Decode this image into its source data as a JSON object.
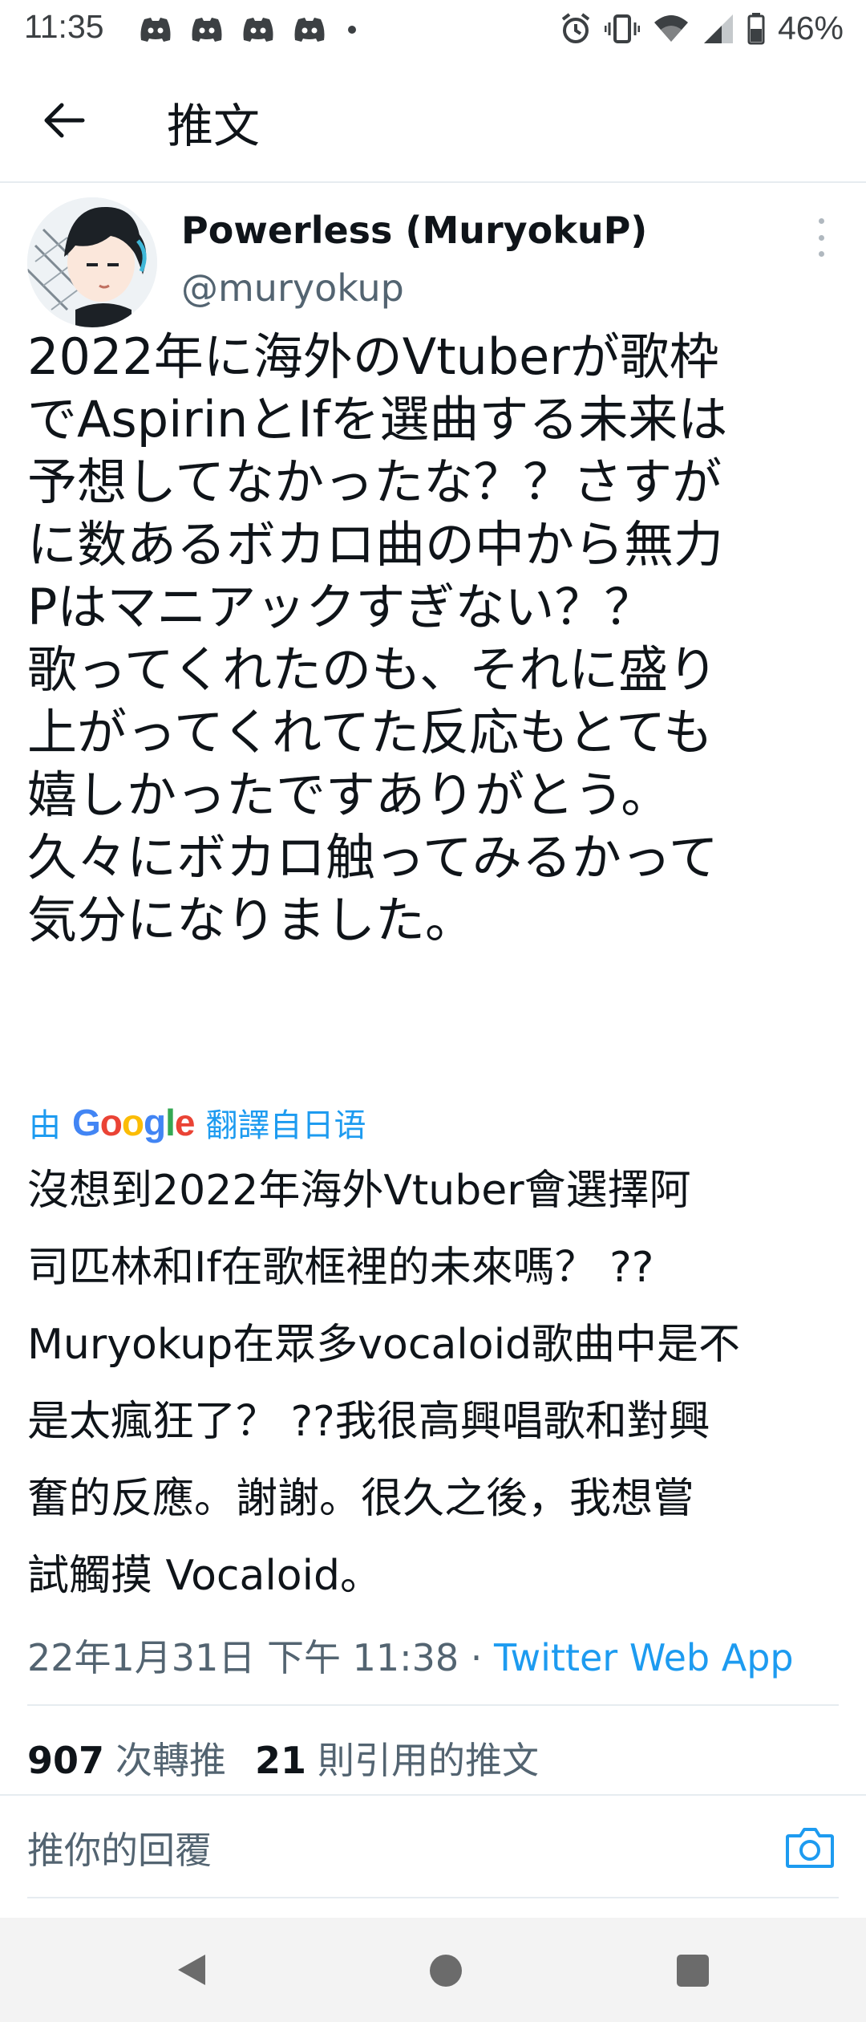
{
  "status_bar": {
    "time": "11:35",
    "battery": "46%",
    "notification_icons": [
      "discord-icon",
      "discord-icon",
      "discord-icon",
      "discord-icon"
    ],
    "system_icons": [
      "alarm-icon",
      "vibrate-icon",
      "wifi-icon",
      "signal-icon",
      "battery-icon"
    ]
  },
  "app_bar": {
    "title": "推文"
  },
  "tweet": {
    "author_name": "Powerless (MuryokuP)",
    "author_handle": "@muryokup",
    "text": "2022年に海外のVtuberが歌枠\nでAspirinとIfを選曲する未来は\n予想してなかったな？？さすが\nに数あるボカロ曲の中から無力\nPはマニアックすぎない？？\n歌ってくれたのも、それに盛り\n上がってくれてた反応もとても\n嬉しかったですありがとう。\n久々にボカロ触ってみるかって\n気分になりました。",
    "translation_prefix": "由",
    "translation_brand": "Google",
    "translation_suffix": "翻譯自日语",
    "translated_text": "沒想到2022年海外Vtuber會選擇阿\n司匹林和If在歌框裡的未來嗎？ ??\nMuryokup在眾多vocaloid歌曲中是不\n是太瘋狂了？ ??我很高興唱歌和對興\n奮的反應。謝謝。很久之後，我想嘗\n試觸摸 Vocaloid。",
    "timestamp": "22年1月31日 下午 11:38",
    "separator": " · ",
    "source_app": "Twitter Web App",
    "retweet_count": "907",
    "retweet_label": "次轉推",
    "quote_count": "21",
    "quote_label": "則引用的推文"
  },
  "reply": {
    "placeholder": "推你的回覆"
  },
  "colors": {
    "accent": "#1d9bf0",
    "secondary_text": "#536471",
    "primary_text": "#0f1419"
  }
}
